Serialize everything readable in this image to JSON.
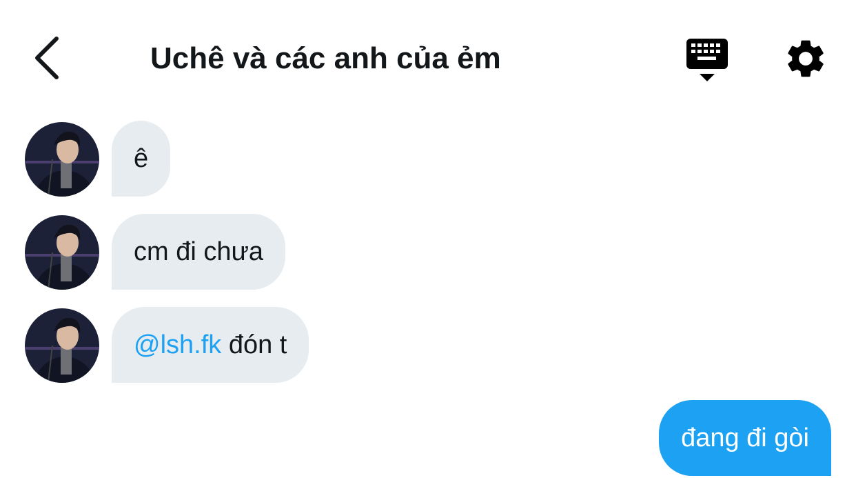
{
  "header": {
    "title": "Uchê và các anh của ẻm",
    "back_icon": "chevron-left-icon",
    "keyboard_icon": "keyboard-icon",
    "settings_icon": "gear-icon"
  },
  "messages": [
    {
      "direction": "incoming",
      "text": "ê"
    },
    {
      "direction": "incoming",
      "text": "cm đi chưa"
    },
    {
      "direction": "incoming",
      "mention": "@lsh.fk",
      "text": " đón t"
    },
    {
      "direction": "outgoing",
      "text": "đang đi gòi"
    }
  ],
  "colors": {
    "accent": "#1da1f2",
    "incoming_bubble": "#e6ecf0",
    "text": "#14171a"
  }
}
